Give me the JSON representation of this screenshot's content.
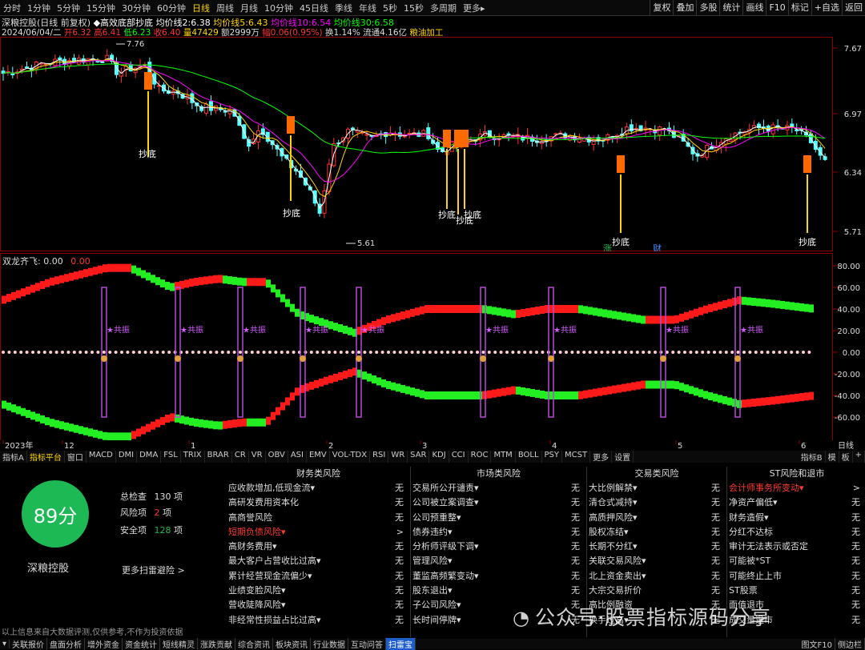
{
  "toolbar": {
    "periods": [
      "分时",
      "1分钟",
      "5分钟",
      "15分钟",
      "30分钟",
      "60分钟",
      "日线",
      "周线",
      "月线",
      "10分钟",
      "45日线",
      "季线",
      "年线",
      "5秒",
      "15秒",
      "多周期",
      "更多▸"
    ],
    "active_index": 6,
    "right_buttons": [
      "复权",
      "叠加",
      "多股",
      "统计",
      "画线",
      "F10",
      "标记",
      "+自选",
      "返回"
    ]
  },
  "header": {
    "line1": {
      "stock": "深粮控股(日线 前复权)",
      "indicator": "◆高效底部抄底",
      "ma2_label": "均价线2:",
      "ma2": "6.38",
      "ma5_label": "均价线5:",
      "ma5": "6.43",
      "ma10_label": "均价线10:",
      "ma10": "6.54",
      "ma30_label": "均价线30:",
      "ma30": "6.58"
    },
    "line2": {
      "date": "2024/06/04/二",
      "open_label": "开",
      "open": "6.32",
      "high_label": "高",
      "high": "6.41",
      "low_label": "低",
      "low": "6.23",
      "close_label": "收",
      "close": "6.40",
      "vol_label": "量",
      "vol": "47429",
      "amt_label": "额",
      "amt": "2999万",
      "chg_label": "幅",
      "chg": "0.06(0.95%)",
      "turn_label": "换",
      "turn": "1.14%",
      "float_label": "流通",
      "float": "4.16亿",
      "industry": "粮油加工"
    }
  },
  "price_chart": {
    "y_ticks": [
      "7.67",
      "6.97",
      "6.34",
      "5.71"
    ],
    "high_mark": "7.76",
    "low_mark": "5.61",
    "signal_label": "抄底",
    "badge_zhang": "涨",
    "badge_cai": "财",
    "colors": {
      "up": "#ff3232",
      "down": "#54ffff",
      "ma2": "#ffffff",
      "ma5": "#ffd400",
      "ma10": "#ff00ff",
      "ma30": "#00ff00",
      "signal": "#ffd400"
    }
  },
  "indicator_panel": {
    "title": "双龙齐飞",
    "value1": ": 0.00",
    "value2": "0.00",
    "y_ticks": [
      "80.00",
      "60.00",
      "40.00",
      "20.00",
      "0.00",
      "-20.00",
      "-40.00",
      "-60.00"
    ],
    "resonance_label": "★共振"
  },
  "x_axis": {
    "labels": [
      "2023年",
      "12",
      "1",
      "2",
      "3",
      "4",
      "5",
      "6"
    ],
    "period_label": "日线"
  },
  "tabs": {
    "items": [
      "指标A",
      "指标平台",
      "窗口",
      "MACD",
      "DMI",
      "DMA",
      "FSL",
      "TRIX",
      "BRAR",
      "CR",
      "VR",
      "OBV",
      "ASI",
      "EMV",
      "VOL-TDX",
      "RSI",
      "WR",
      "SAR",
      "KDJ",
      "CCI",
      "ROC",
      "MTM",
      "BOLL",
      "PSY",
      "MCST",
      "更多",
      "设置"
    ],
    "right": [
      "指标B",
      "模",
      "板",
      "+"
    ]
  },
  "risk": {
    "score": "89分",
    "name": "深粮控股",
    "total_label": "总检查",
    "total": "130",
    "total_unit": "项",
    "risk_label": "风险项",
    "risk": "2",
    "risk_unit": "项",
    "safe_label": "安全项",
    "safe": "128",
    "safe_unit": "项",
    "more": "更多扫雷避险 >",
    "disclaimer": "以上信息来自大数据评测,仅供参考,不作为投资依据",
    "columns": [
      {
        "title": "财务类风险",
        "rows": [
          {
            "label": "应收款增加,低现金流▾",
            "value": "无"
          },
          {
            "label": "高研发费用资本化",
            "value": "无"
          },
          {
            "label": "高商誉风险",
            "value": "无"
          },
          {
            "label": "短期负债风险▾",
            "value": ">",
            "red": true
          },
          {
            "label": "高财务费用▾",
            "value": "无"
          },
          {
            "label": "最大客户占营收比过高▾",
            "value": "无"
          },
          {
            "label": "累计经营现金流偏少▾",
            "value": "无"
          },
          {
            "label": "业绩变脸风险▾",
            "value": "无"
          },
          {
            "label": "营收陡降风险▾",
            "value": "无"
          },
          {
            "label": "非经常性损益占比过高▾",
            "value": "无"
          }
        ]
      },
      {
        "title": "市场类风险",
        "rows": [
          {
            "label": "交易所公开谴责▾",
            "value": "无"
          },
          {
            "label": "公司被立案调查▾",
            "value": "无"
          },
          {
            "label": "公司预重整▾",
            "value": "无"
          },
          {
            "label": "债券违约▾",
            "value": "无"
          },
          {
            "label": "分析师评级下调▾",
            "value": "无"
          },
          {
            "label": "管理风险▾",
            "value": "无"
          },
          {
            "label": "董监高频繁变动▾",
            "value": "无"
          },
          {
            "label": "股东退出▾",
            "value": "无"
          },
          {
            "label": "子公司风险▾",
            "value": "无"
          },
          {
            "label": "长时间停牌▾",
            "value": "无"
          }
        ]
      },
      {
        "title": "交易类风险",
        "rows": [
          {
            "label": "大比例解禁▾",
            "value": "无"
          },
          {
            "label": "清仓式减持▾",
            "value": "无"
          },
          {
            "label": "高质押风险▾",
            "value": "无"
          },
          {
            "label": "股权冻结▾",
            "value": "无"
          },
          {
            "label": "长期不分红▾",
            "value": "无"
          },
          {
            "label": "关联交易风险▾",
            "value": "无"
          },
          {
            "label": "北上资金卖出▾",
            "value": "无"
          },
          {
            "label": "大宗交易折价",
            "value": "无"
          },
          {
            "label": "高比例融资",
            "value": "无"
          },
          {
            "label": "换手过高▾",
            "value": "无"
          }
        ]
      },
      {
        "title": "ST风险和退市",
        "rows": [
          {
            "label": "会计师事务所变动▾",
            "value": ">",
            "red": true
          },
          {
            "label": "净资产偏低▾",
            "value": "无"
          },
          {
            "label": "财务造假▾",
            "value": "无"
          },
          {
            "label": "分红不达标",
            "value": "无"
          },
          {
            "label": "审计无法表示或否定",
            "value": "无"
          },
          {
            "label": "可能被*ST",
            "value": "无"
          },
          {
            "label": "可能终止上市",
            "value": "无"
          },
          {
            "label": "ST股票",
            "value": "无"
          },
          {
            "label": "面值退市",
            "value": "无"
          },
          {
            "label": "成交量退市",
            "value": "无"
          }
        ]
      }
    ]
  },
  "watermark": "公众号·股票指标源码分享",
  "bottom_tabs": {
    "items": [
      "关联报价",
      "盘面分析",
      "增外资金",
      "资金统计",
      "短线精灵",
      "涨跌贡献",
      "综合资讯",
      "板块资讯",
      "行业数据",
      "互动问答",
      "扫雷宝"
    ],
    "selected": "扫雷宝",
    "right": [
      "图文F10",
      "侧边栏"
    ]
  }
}
